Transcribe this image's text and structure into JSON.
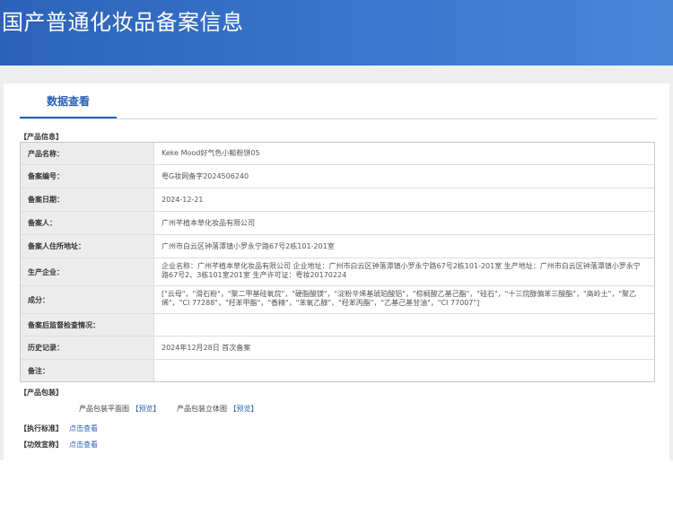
{
  "header": {
    "title": "国产普通化妆品备案信息"
  },
  "tabs": [
    {
      "label": "数据查看"
    }
  ],
  "product_section": {
    "label": "【产品信息】"
  },
  "fields": [
    {
      "key": "产品名称：",
      "value": "Keke Mood好气色小鲸粉饼05"
    },
    {
      "key": "备案编号：",
      "value": "粤G妆网备字2024506240"
    },
    {
      "key": "备案日期：",
      "value": "2024-12-21"
    },
    {
      "key": "备案人：",
      "value": "广州芊植本草化妆品有限公司"
    },
    {
      "key": "备案人住所地址：",
      "value": "广州市白云区钟落潭镇小罗永宁路67号2栋101-201室"
    },
    {
      "key": "生产企业：",
      "value": "企业名称：广州芊植本草化妆品有限公司 企业地址：广州市白云区钟落潭镇小罗永宁路67号2栋101-201室 生产地址：广州市白云区钟落潭镇小罗永宁路67号2、3栋101室201室 生产许可证：粤妆20170224"
    },
    {
      "key": "成分：",
      "value": "[\"云母\"，\"滑石粉\"，\"聚二甲基硅氧烷\"，\"硬脂酸镁\"，\"淀粉辛烯基琥珀酸铝\"，\"棕榈酸乙基己酯\"，\"硅石\"，\"十三烷醇偏苯三酸酯\"，\"高岭土\"，\"聚乙烯\"，\"CI 77288\"，\"羟苯甲酯\"，\"香精\"，\"苯氧乙醇\"，\"羟苯丙酯\"，\"乙基己基甘油\"，\"CI 77007\"]"
    },
    {
      "key": "备案后监督检查情况：",
      "value": ""
    },
    {
      "key": "历史记录：",
      "value": "2024年12月28日 首次备案"
    },
    {
      "key": "备注：",
      "value": ""
    }
  ],
  "package_section": {
    "label": "【产品包装】",
    "flat_label": "产品包装平面图",
    "flat_link": "【预览】",
    "solid_label": "产品包装立体图",
    "solid_link": "【预览】"
  },
  "standard_section": {
    "label": "【执行标准】",
    "link": "点击查看"
  },
  "efficacy_section": {
    "label": "【功效宣称】",
    "link": "点击查看"
  },
  "colors": {
    "banner": "#3b78cf",
    "accent": "#2a62b5",
    "key_bg": "#ececec"
  }
}
